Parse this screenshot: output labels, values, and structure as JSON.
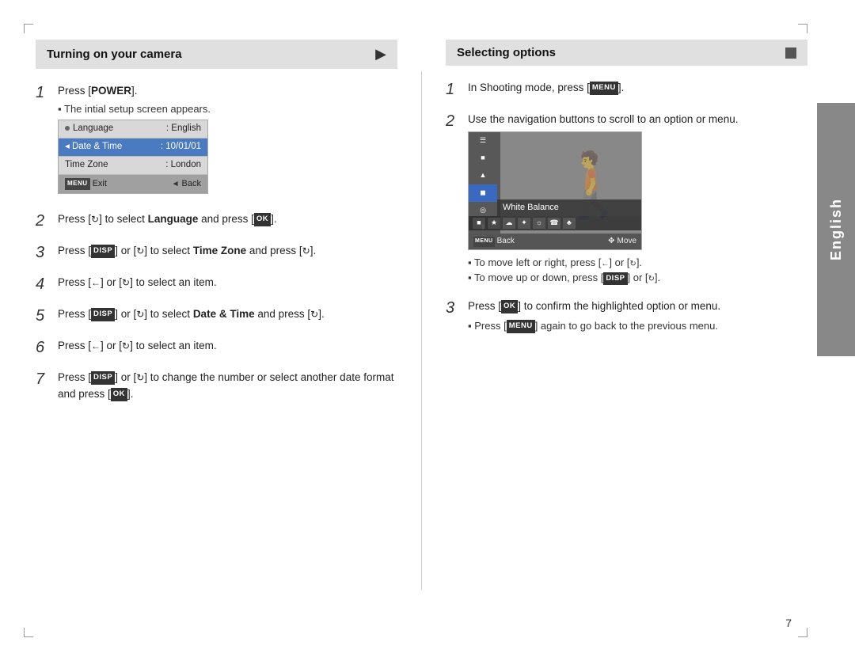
{
  "page": {
    "number": "7",
    "side_tab": "English"
  },
  "left": {
    "header": "Turning on your camera",
    "steps": [
      {
        "num": "1",
        "main": "Press [POWER].",
        "bullets": [
          "The intial setup screen appears."
        ]
      },
      {
        "num": "2",
        "main": "Press [rotate] to select Language and press [OK]."
      },
      {
        "num": "3",
        "main": "Press [DISP] or [rotate] to select Time Zone and press [rotate]."
      },
      {
        "num": "4",
        "main": "Press [left] or [rotate] to select an item."
      },
      {
        "num": "5",
        "main": "Press [DISP] or [rotate] to select Date & Time and press [rotate]."
      },
      {
        "num": "6",
        "main": "Press [left] or [rotate] to select an item."
      },
      {
        "num": "7",
        "main": "Press [DISP] or [rotate] to change the number or select another date format and press [OK]."
      }
    ],
    "lcd": {
      "rows": [
        {
          "label": "Language",
          "value": ": English",
          "selected": false
        },
        {
          "label": "Date & Time",
          "value": ": 10/01/01",
          "selected": true
        },
        {
          "label": "Time Zone",
          "value": ": London",
          "selected": false
        }
      ],
      "footer_left": "Exit",
      "footer_right": "Back"
    }
  },
  "right": {
    "header": "Selecting options",
    "steps": [
      {
        "num": "1",
        "main": "In Shooting mode, press [MENU]."
      },
      {
        "num": "2",
        "main": "Use the navigation buttons to scroll to an option or menu."
      },
      {
        "num": "3",
        "main": "Press [OK] to confirm the highlighted option or menu.",
        "bullets": [
          "Press [MENU] again to go back to the previous menu."
        ]
      }
    ],
    "wb_label": "White Balance",
    "wb_footer_left": "Back",
    "wb_footer_right": "Move",
    "notes": [
      "To move left or right, press [left] or [rotate].",
      "To move up or down, press [DISP] or [rotate]."
    ]
  }
}
